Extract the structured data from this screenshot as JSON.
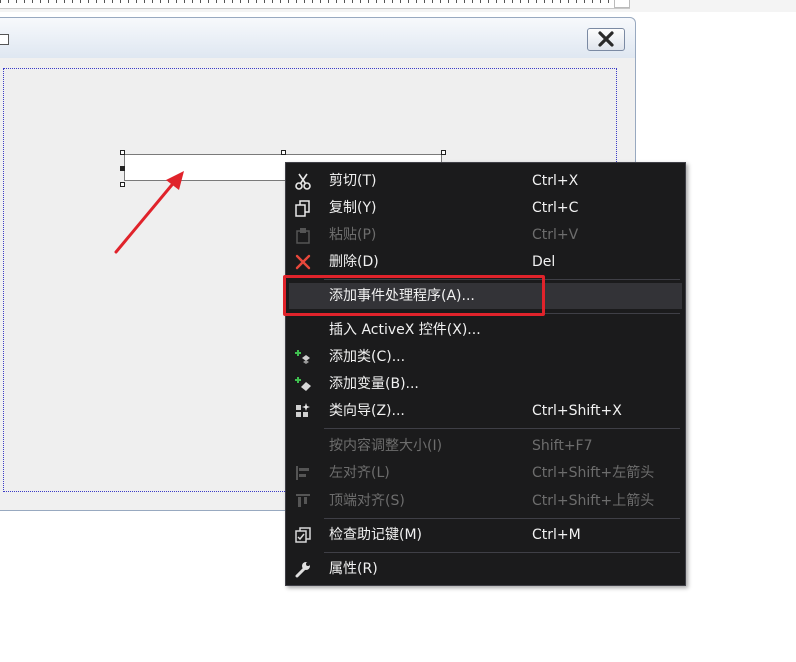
{
  "menu": {
    "items": [
      {
        "label": "剪切(T)",
        "shortcut": "Ctrl+X",
        "icon": "cut-icon",
        "enabled": true
      },
      {
        "label": "复制(Y)",
        "shortcut": "Ctrl+C",
        "icon": "copy-icon",
        "enabled": true
      },
      {
        "label": "粘贴(P)",
        "shortcut": "Ctrl+V",
        "icon": "paste-icon",
        "enabled": false
      },
      {
        "label": "删除(D)",
        "shortcut": "Del",
        "icon": "delete-icon",
        "enabled": true
      },
      {
        "label": "添加事件处理程序(A)...",
        "shortcut": "",
        "icon": "",
        "enabled": true,
        "highlighted": true
      },
      {
        "label": "插入 ActiveX 控件(X)...",
        "shortcut": "",
        "icon": "",
        "enabled": true
      },
      {
        "label": "添加类(C)...",
        "shortcut": "",
        "icon": "add-class-icon",
        "enabled": true
      },
      {
        "label": "添加变量(B)...",
        "shortcut": "",
        "icon": "add-variable-icon",
        "enabled": true
      },
      {
        "label": "类向导(Z)...",
        "shortcut": "Ctrl+Shift+X",
        "icon": "class-wizard-icon",
        "enabled": true
      },
      {
        "label": "按内容调整大小(I)",
        "shortcut": "Shift+F7",
        "icon": "",
        "enabled": false
      },
      {
        "label": "左对齐(L)",
        "shortcut": "Ctrl+Shift+左箭头",
        "icon": "align-left-icon",
        "enabled": false
      },
      {
        "label": "顶端对齐(S)",
        "shortcut": "Ctrl+Shift+上箭头",
        "icon": "align-top-icon",
        "enabled": false
      },
      {
        "label": "检查助记键(M)",
        "shortcut": "Ctrl+M",
        "icon": "check-mnemonics-icon",
        "enabled": true
      },
      {
        "label": "属性(R)",
        "shortcut": "",
        "icon": "wrench-icon",
        "enabled": true
      }
    ]
  },
  "colors": {
    "menu_bg": "#1b1b1c",
    "menu_text": "#f1f1f1",
    "menu_disabled": "#6d6d6d",
    "annotation_red": "#e0232b"
  }
}
